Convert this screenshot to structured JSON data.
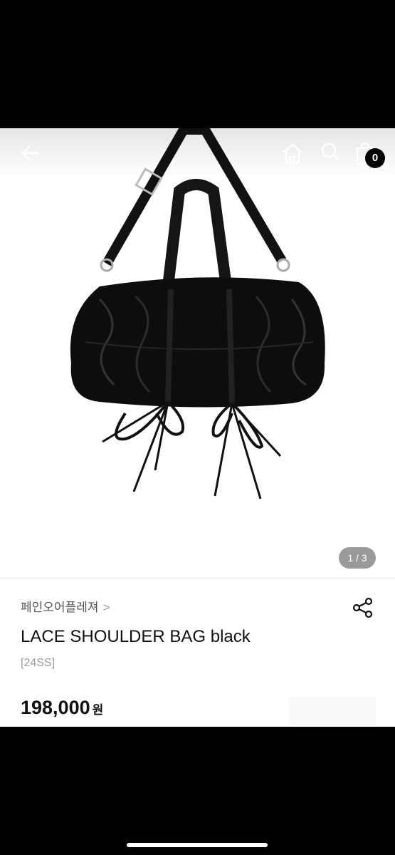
{
  "header": {
    "back_icon": "back-arrow-icon",
    "home_icon": "home-icon",
    "search_icon": "search-icon",
    "bag_icon": "shopping-bag-icon",
    "cart_count": "0"
  },
  "gallery": {
    "pager": "1 / 3"
  },
  "product": {
    "brand": "페인오어플레져",
    "brand_chevron": ">",
    "title": "LACE SHOULDER BAG black",
    "season": "[24SS]",
    "price": "198,000",
    "currency": "원",
    "share_icon": "share-icon"
  }
}
